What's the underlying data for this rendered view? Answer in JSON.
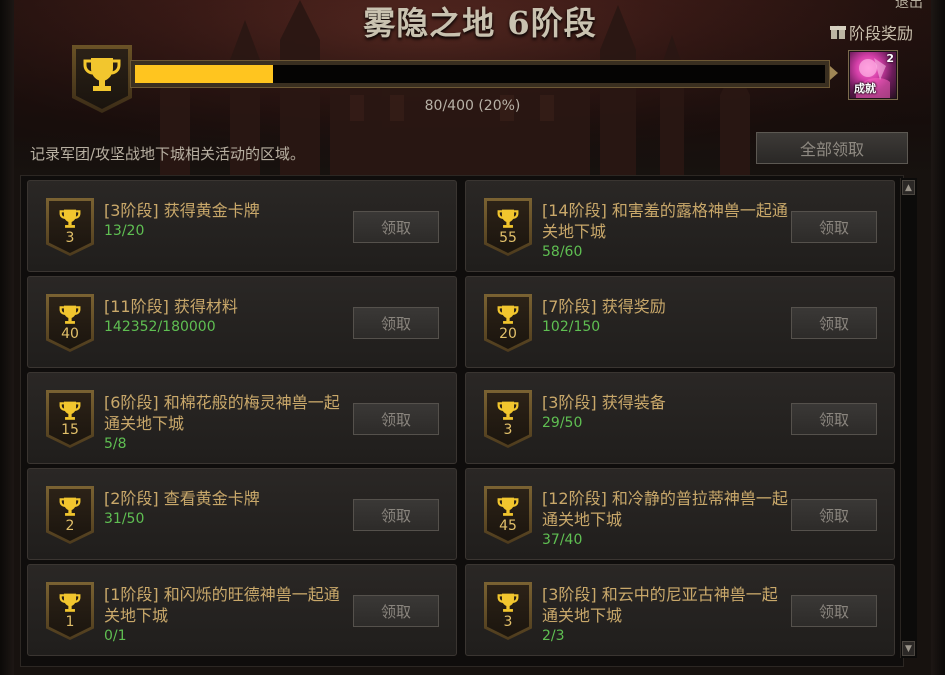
{
  "header": {
    "title": "雾隐之地 6阶段",
    "top_right_fragment": "退出",
    "stage_reward_label": "阶段奖励",
    "reward_item": {
      "count": "2",
      "text": "成就",
      "accent": "#d43fa8"
    }
  },
  "progress": {
    "text": "80/400 (20%)",
    "fraction": 0.2,
    "fill_color": "#ffc51f"
  },
  "description": "记录军团/攻坚战地下城相关活动的区域。",
  "claim_all_label": "全部领取",
  "scroll": {
    "up": "▲",
    "down": "▼"
  },
  "cards": [
    {
      "level": "3",
      "title": "[3阶段] 获得黄金卡牌",
      "progress": "13/20",
      "button": "领取"
    },
    {
      "level": "55",
      "title": "[14阶段] 和害羞的露格神兽一起通关地下城",
      "progress": "58/60",
      "button": "领取"
    },
    {
      "level": "40",
      "title": "[11阶段] 获得材料",
      "progress": "142352/180000",
      "button": "领取"
    },
    {
      "level": "20",
      "title": "[7阶段] 获得奖励",
      "progress": "102/150",
      "button": "领取"
    },
    {
      "level": "15",
      "title": "[6阶段] 和棉花般的梅灵神兽一起通关地下城",
      "progress": "5/8",
      "button": "领取"
    },
    {
      "level": "3",
      "title": "[3阶段] 获得装备",
      "progress": "29/50",
      "button": "领取"
    },
    {
      "level": "2",
      "title": "[2阶段] 查看黄金卡牌",
      "progress": "31/50",
      "button": "领取"
    },
    {
      "level": "45",
      "title": "[12阶段] 和冷静的普拉蒂神兽一起通关地下城",
      "progress": "37/40",
      "button": "领取"
    },
    {
      "level": "1",
      "title": "[1阶段] 和闪烁的旺德神兽一起通关地下城",
      "progress": "0/1",
      "button": "领取"
    },
    {
      "level": "3",
      "title": "[3阶段] 和云中的尼亚古神兽一起通关地下城",
      "progress": "2/3",
      "button": "领取"
    }
  ]
}
